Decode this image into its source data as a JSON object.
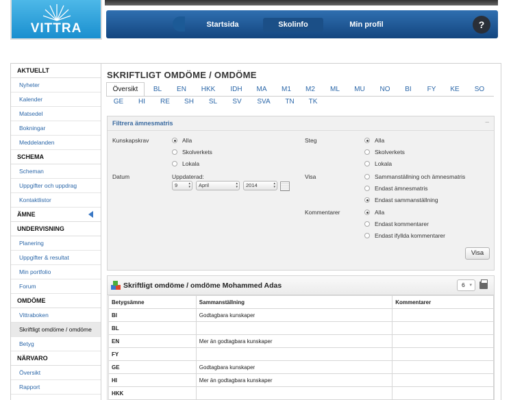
{
  "brand": {
    "logo_text": "VITTRA"
  },
  "nav": {
    "items": [
      {
        "label": "Startsida"
      },
      {
        "label": "Skolinfo",
        "active": true
      },
      {
        "label": "Min profil"
      }
    ],
    "help_label": "?"
  },
  "sidebar": {
    "sections": [
      {
        "heading": "AKTUELLT",
        "items": [
          "Nyheter",
          "Kalender",
          "Matsedel",
          "Bokningar",
          "Meddelanden"
        ]
      },
      {
        "heading": "SCHEMA",
        "items": [
          "Scheman",
          "Uppgifter och uppdrag",
          "Kontaktlistor"
        ]
      },
      {
        "heading": "ÄMNE",
        "items": []
      },
      {
        "heading": "UNDERVISNING",
        "items": [
          "Planering",
          "Uppgifter & resultat",
          "Min portfolio",
          "Forum"
        ]
      },
      {
        "heading": "OMDÖME",
        "items": [
          "Vittraboken",
          "Skriftligt omdöme / omdöme",
          "Betyg"
        ]
      },
      {
        "heading": "NÄRVARO",
        "items": [
          "Översikt",
          "Rapport"
        ]
      }
    ],
    "active_item": "Skriftligt omdöme / omdöme"
  },
  "page": {
    "title": "SKRIFTLIGT OMDÖME / OMDÖME"
  },
  "subjects": {
    "row1": [
      "Översikt",
      "BL",
      "EN",
      "HKK",
      "IDH",
      "MA",
      "M1",
      "M2",
      "ML",
      "MU",
      "NO",
      "BI",
      "FY",
      "KE",
      "SO"
    ],
    "row2": [
      "GE",
      "HI",
      "RE",
      "SH",
      "SL",
      "SV",
      "SVA",
      "TN",
      "TK"
    ],
    "active": "Översikt"
  },
  "filter": {
    "title": "Filtrera ämnesmatris",
    "kunskapskrav": {
      "label": "Kunskapskrav",
      "options": [
        "Alla",
        "Skolverkets",
        "Lokala"
      ],
      "selected": 0
    },
    "steg": {
      "label": "Steg",
      "options": [
        "Alla",
        "Skolverkets",
        "Lokala"
      ],
      "selected": 0
    },
    "datum": {
      "label": "Datum",
      "sublabel": "Uppdaterad:",
      "day": "9",
      "month": "April",
      "year": "2014"
    },
    "visa": {
      "label": "Visa",
      "options": [
        "Sammanställning och ämnesmatris",
        "Endast ämnesmatris",
        "Endast sammanställning"
      ],
      "selected": 2
    },
    "kommentarer": {
      "label": "Kommentarer",
      "options": [
        "Alla",
        "Endast kommentarer",
        "Endast ifyllda kommentarer"
      ],
      "selected": 0
    },
    "button_label": "Visa"
  },
  "results": {
    "title": "Skriftligt omdöme / omdöme Mohammed Adas",
    "count": "6",
    "columns": [
      "Betygsämne",
      "Sammanställning",
      "Kommentarer"
    ],
    "rows": [
      {
        "subject": "BI",
        "summary": "Godtagbara kunskaper",
        "comment": ""
      },
      {
        "subject": "BL",
        "summary": "",
        "comment": ""
      },
      {
        "subject": "EN",
        "summary": "Mer än godtagbara kunskaper",
        "comment": ""
      },
      {
        "subject": "FY",
        "summary": "",
        "comment": ""
      },
      {
        "subject": "GE",
        "summary": "Godtagbara kunskaper",
        "comment": ""
      },
      {
        "subject": "HI",
        "summary": "Mer än godtagbara kunskaper",
        "comment": ""
      },
      {
        "subject": "HKK",
        "summary": "",
        "comment": ""
      }
    ]
  }
}
